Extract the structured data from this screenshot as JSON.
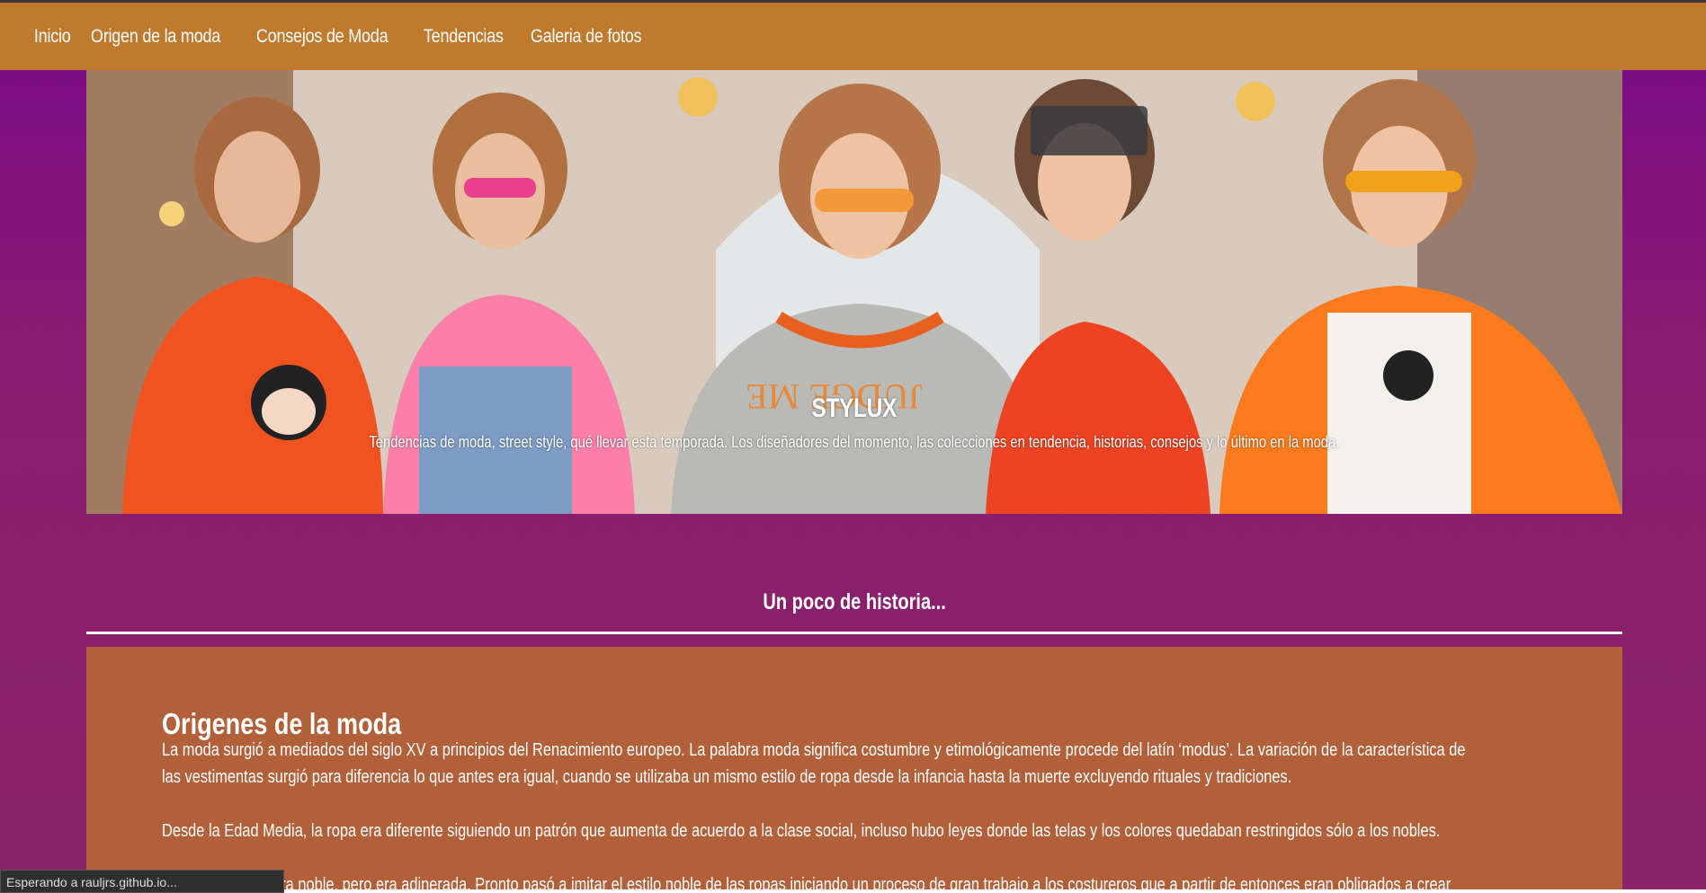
{
  "nav": {
    "items": [
      {
        "label": "Inicio"
      },
      {
        "label": "Origen de la moda"
      },
      {
        "label": "Consejos de Moda"
      },
      {
        "label": "Tendencias"
      },
      {
        "label": "Galeria de fotos"
      }
    ]
  },
  "hero": {
    "title": "STYLUX",
    "subtitle": "Tendencias de moda, street style, qué llevar esta temporada. Los diseñadores del momento, las colecciones en tendencia, historias, consejos y lo último en la moda."
  },
  "section": {
    "title": "Un poco de historia..."
  },
  "article": {
    "heading": "Origenes de la moda",
    "paragraphs": [
      "La moda surgió a mediados del siglo XV a principios del Renacimiento europeo. La palabra moda significa costumbre y etimológicamente procede del latín ‘modus’. La variación de la característica de las vestimentas surgió para diferencia lo que antes era igual, cuando se utilizaba un mismo estilo de ropa desde la infancia hasta la muerte excluyendo rituales y tradiciones.",
      "Desde la Edad Media, la ropa era diferente siguiendo un patrón que aumenta de acuerdo a la clase social, incluso hubo leyes donde las telas y los colores quedaban restringidos sólo a los nobles.",
      "La burguesía no era noble, pero era adinerada. Pronto pasó a imitar el estilo noble de las ropas iniciando un proceso de gran trabajo a los costureros que a partir de entonces eran obligados a crear estilos que distinguieran a la nobleza respecto a la burguesía."
    ]
  },
  "status": {
    "text": "Esperando a rauljrs.github.io..."
  },
  "colors": {
    "navbar": "#bf7a2e",
    "background": "#7a0a86",
    "card": "#b1603a"
  }
}
